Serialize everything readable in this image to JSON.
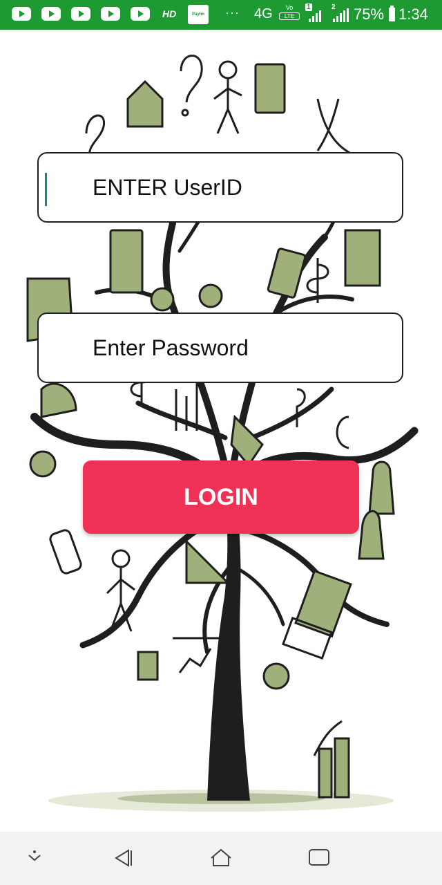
{
  "status_bar": {
    "notification_icons": [
      "youtube-icon",
      "youtube-icon",
      "youtube-icon",
      "youtube-icon",
      "youtube-icon"
    ],
    "hd_label": "HD",
    "paytm_label": "Paytm",
    "more_label": "···",
    "network_type": "4G",
    "volte_label": "Vo",
    "lte_label": "LTE",
    "sim1_badge": "1",
    "sim2_badge": "2",
    "battery_percent": "75%",
    "time": "1:34",
    "color": "#1d9b32"
  },
  "login_form": {
    "userid_placeholder": "ENTER UserID",
    "password_placeholder": "Enter Password",
    "login_label": "LOGIN",
    "accent_color": "#ef3156"
  },
  "nav_bar": {
    "icons": [
      "expand-down-icon",
      "back-icon",
      "home-icon",
      "recents-icon"
    ]
  }
}
